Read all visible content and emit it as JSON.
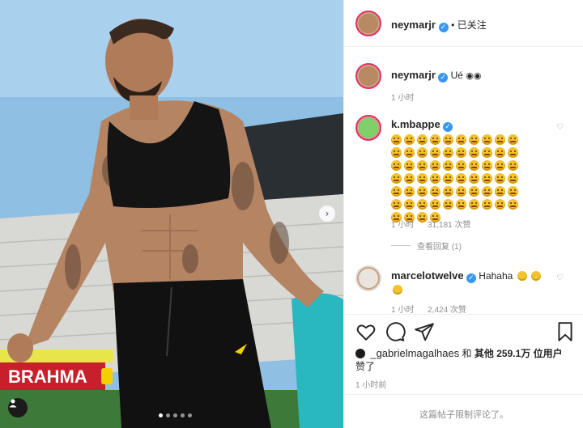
{
  "post": {
    "author": "neymarjr",
    "follow_status": "已关注",
    "caption": "Ué",
    "caption_time": "1 小时",
    "carousel_next_icon": "chevron-right-icon",
    "user_tag_icon": "person-icon"
  },
  "comments": [
    {
      "username": "k.mbappe",
      "emoji_count": 64,
      "emoji_name": "grinning-face-with-sweat",
      "time": "1 小时",
      "likes": "31,181 次赞",
      "view_replies": "查看回复 (1)"
    },
    {
      "username": "marcelotwelve",
      "text": "Hahaha",
      "time": "1 小时",
      "likes": "2,424 次赞"
    }
  ],
  "actions": {
    "like_icon": "heart-icon",
    "comment_icon": "comment-icon",
    "share_icon": "send-icon",
    "save_icon": "bookmark-icon"
  },
  "likes_line": {
    "liker": "_gabrielmagalhaes",
    "and": "和",
    "others": "其他 259.1万 位用户",
    "suffix": "赞了"
  },
  "post_time": "1 小时前",
  "comments_limited_note": "这篇帖子限制评论了。",
  "colors": {
    "verified": "#3897f0",
    "story_ring": "#e1306c",
    "muted_text": "#8e8e8e"
  }
}
